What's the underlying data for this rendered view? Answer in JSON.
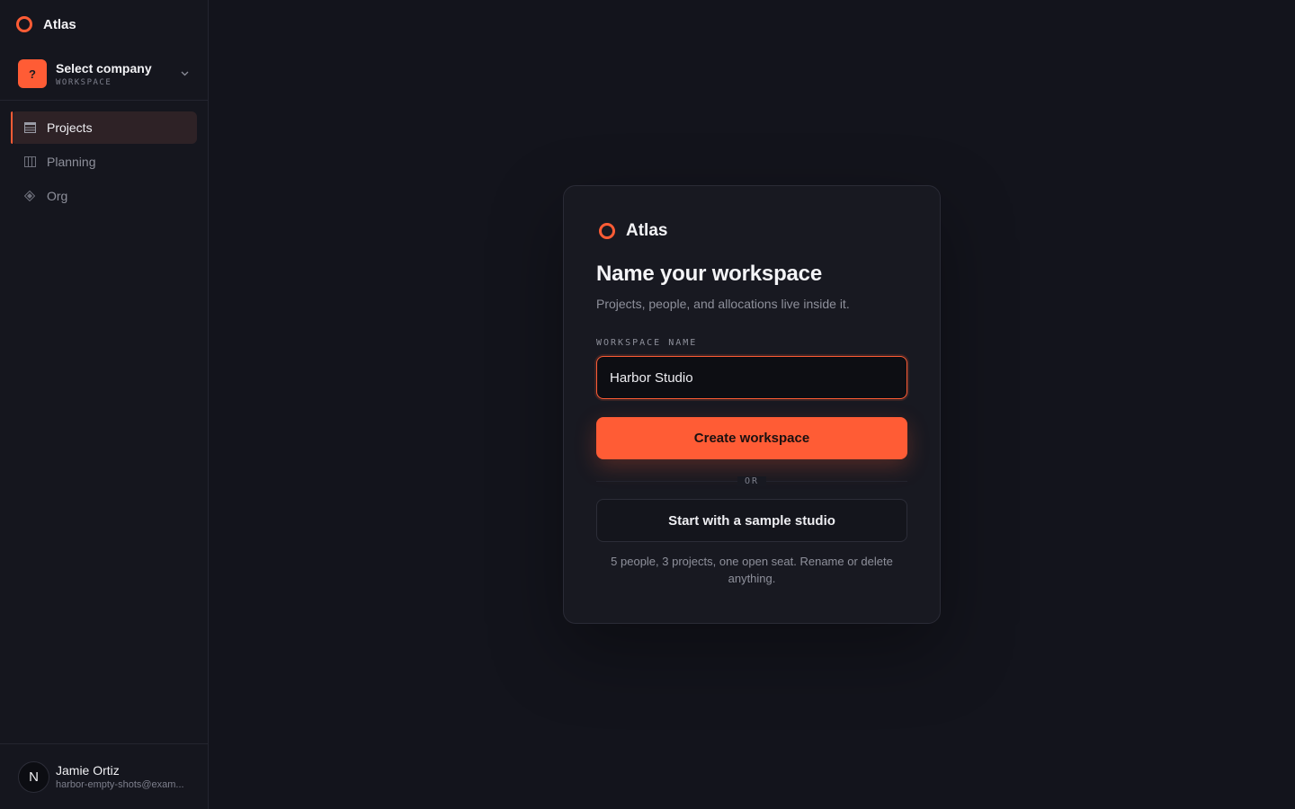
{
  "app": {
    "name": "Atlas",
    "accent": "#ff5c35"
  },
  "sidebar": {
    "company": {
      "badge": "?",
      "name": "Select company",
      "subtitle": "WORKSPACE"
    },
    "items": [
      {
        "label": "Projects",
        "icon": "table-icon",
        "active": true
      },
      {
        "label": "Planning",
        "icon": "columns-icon",
        "active": false
      },
      {
        "label": "Org",
        "icon": "diamond-icon",
        "active": false
      }
    ],
    "user": {
      "initial": "N",
      "name": "Jamie Ortiz",
      "email": "harbor-empty-shots@exam..."
    }
  },
  "card": {
    "brand": "Atlas",
    "title": "Name your workspace",
    "subtitle": "Projects, people, and allocations live inside it.",
    "field_label": "WORKSPACE NAME",
    "field_value": "Harbor Studio",
    "primary_button": "Create workspace",
    "divider_text": "OR",
    "secondary_button": "Start with a sample studio",
    "hint": "5 people, 3 projects, one open seat. Rename or delete anything."
  }
}
